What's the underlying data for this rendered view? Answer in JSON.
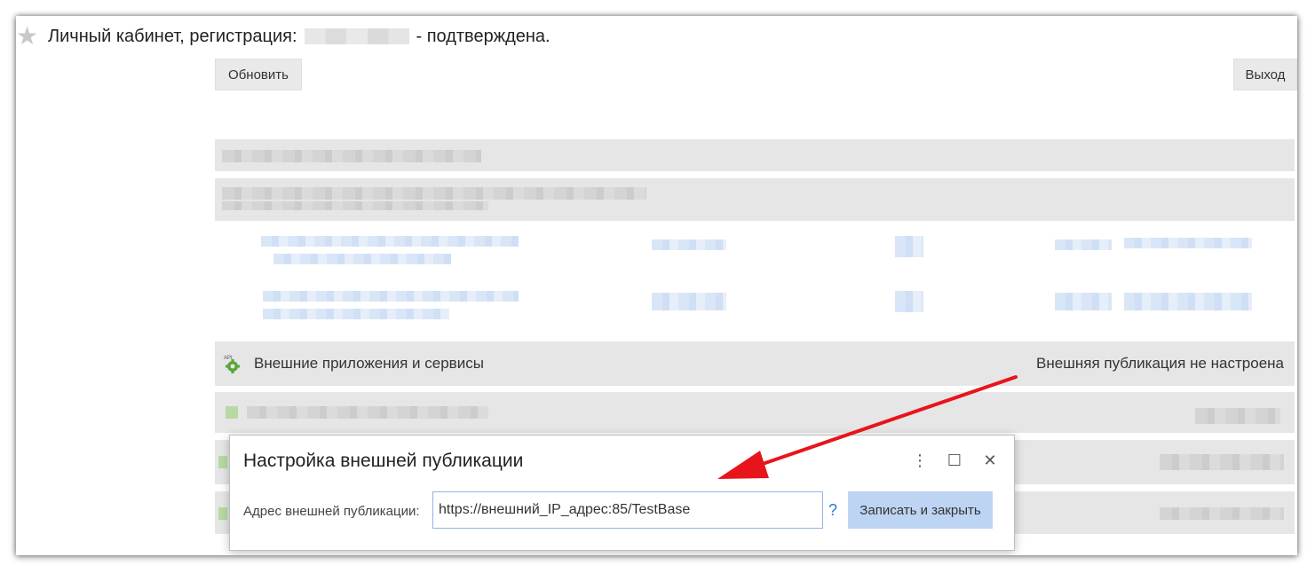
{
  "header": {
    "title_prefix": "Личный кабинет, регистрация:",
    "title_suffix": "- подтверждена."
  },
  "toolbar": {
    "refresh_label": "Обновить",
    "exit_label": "Выход"
  },
  "external_services": {
    "label": "Внешние приложения и сервисы",
    "status": "Внешняя публикация не настроена"
  },
  "dialog": {
    "title": "Настройка внешней публикации",
    "field_label": "Адрес внешней публикации:",
    "field_value": "https://внешний_IP_адрес:85/TestBase",
    "help": "?",
    "save_label": "Записать и закрыть"
  },
  "icons": {
    "star": "star-icon",
    "api": "api-gear-icon",
    "more": "more-vertical-icon",
    "maximize": "maximize-icon",
    "close": "close-icon"
  },
  "colors": {
    "arrow": "#e8141b",
    "accent_button": "#bed4f3",
    "input_border": "#8fb5e6"
  }
}
